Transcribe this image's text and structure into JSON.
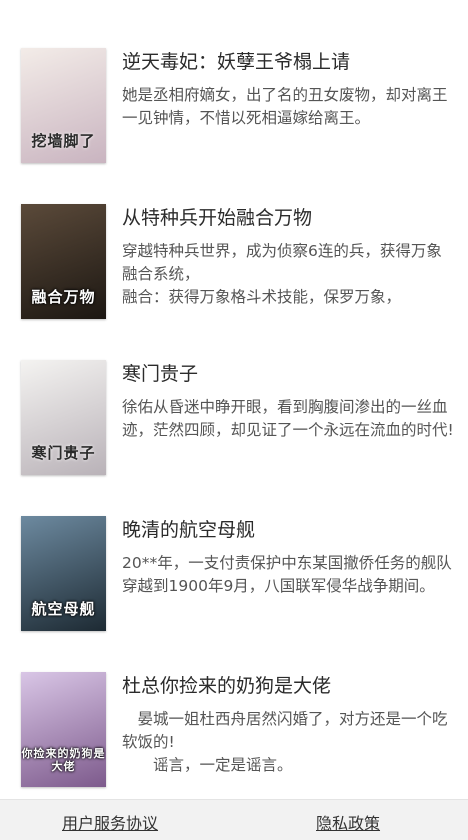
{
  "books": [
    {
      "title": "逆天毒妃：妖孽王爷榻上请",
      "description": "她是丞相府嫡女，出了名的丑女废物，却对离王一见钟情，不惜以死相逼嫁给离王。",
      "cover_text": "挖墙脚了",
      "cover_colors": [
        "#f3ece8",
        "#c9b4c0"
      ],
      "cover_text_dark": true
    },
    {
      "title": "从特种兵开始融合万物",
      "description": "穿越特种兵世界，成为侦察6连的兵，获得万象融合系统，\n融合：获得万象格斗术技能，保罗万象，",
      "cover_text": "融合万物",
      "cover_colors": [
        "#5b4a3a",
        "#1c1712"
      ],
      "cover_text_dark": false
    },
    {
      "title": "寒门贵子",
      "description": "徐佑从昏迷中睁开眼，看到胸腹间渗出的一丝血迹，茫然四顾，却见证了一个永远在流血的时代!",
      "cover_text": "寒门贵子",
      "cover_colors": [
        "#f4f3f1",
        "#b9b2b8"
      ],
      "cover_text_dark": true
    },
    {
      "title": "晚清的航空母舰",
      "description": "20**年，一支付责保护中东某国撤侨任务的舰队穿越到1900年9月，八国联军侵华战争期间。",
      "cover_text": "航空母舰",
      "cover_colors": [
        "#6d8aa0",
        "#1d2a33"
      ],
      "cover_text_dark": false
    },
    {
      "title": "杜总你捡来的奶狗是大佬",
      "description": "　晏城一姐杜西舟居然闪婚了，对方还是一个吃软饭的!\n　　谣言，一定是谣言。",
      "cover_text": "你捡来的奶狗是大佬",
      "cover_colors": [
        "#d9c6e6",
        "#7d5a8c"
      ],
      "cover_text_dark": false
    }
  ],
  "footer": {
    "agreement_label": "用户服务协议",
    "privacy_label": "隐私政策"
  }
}
